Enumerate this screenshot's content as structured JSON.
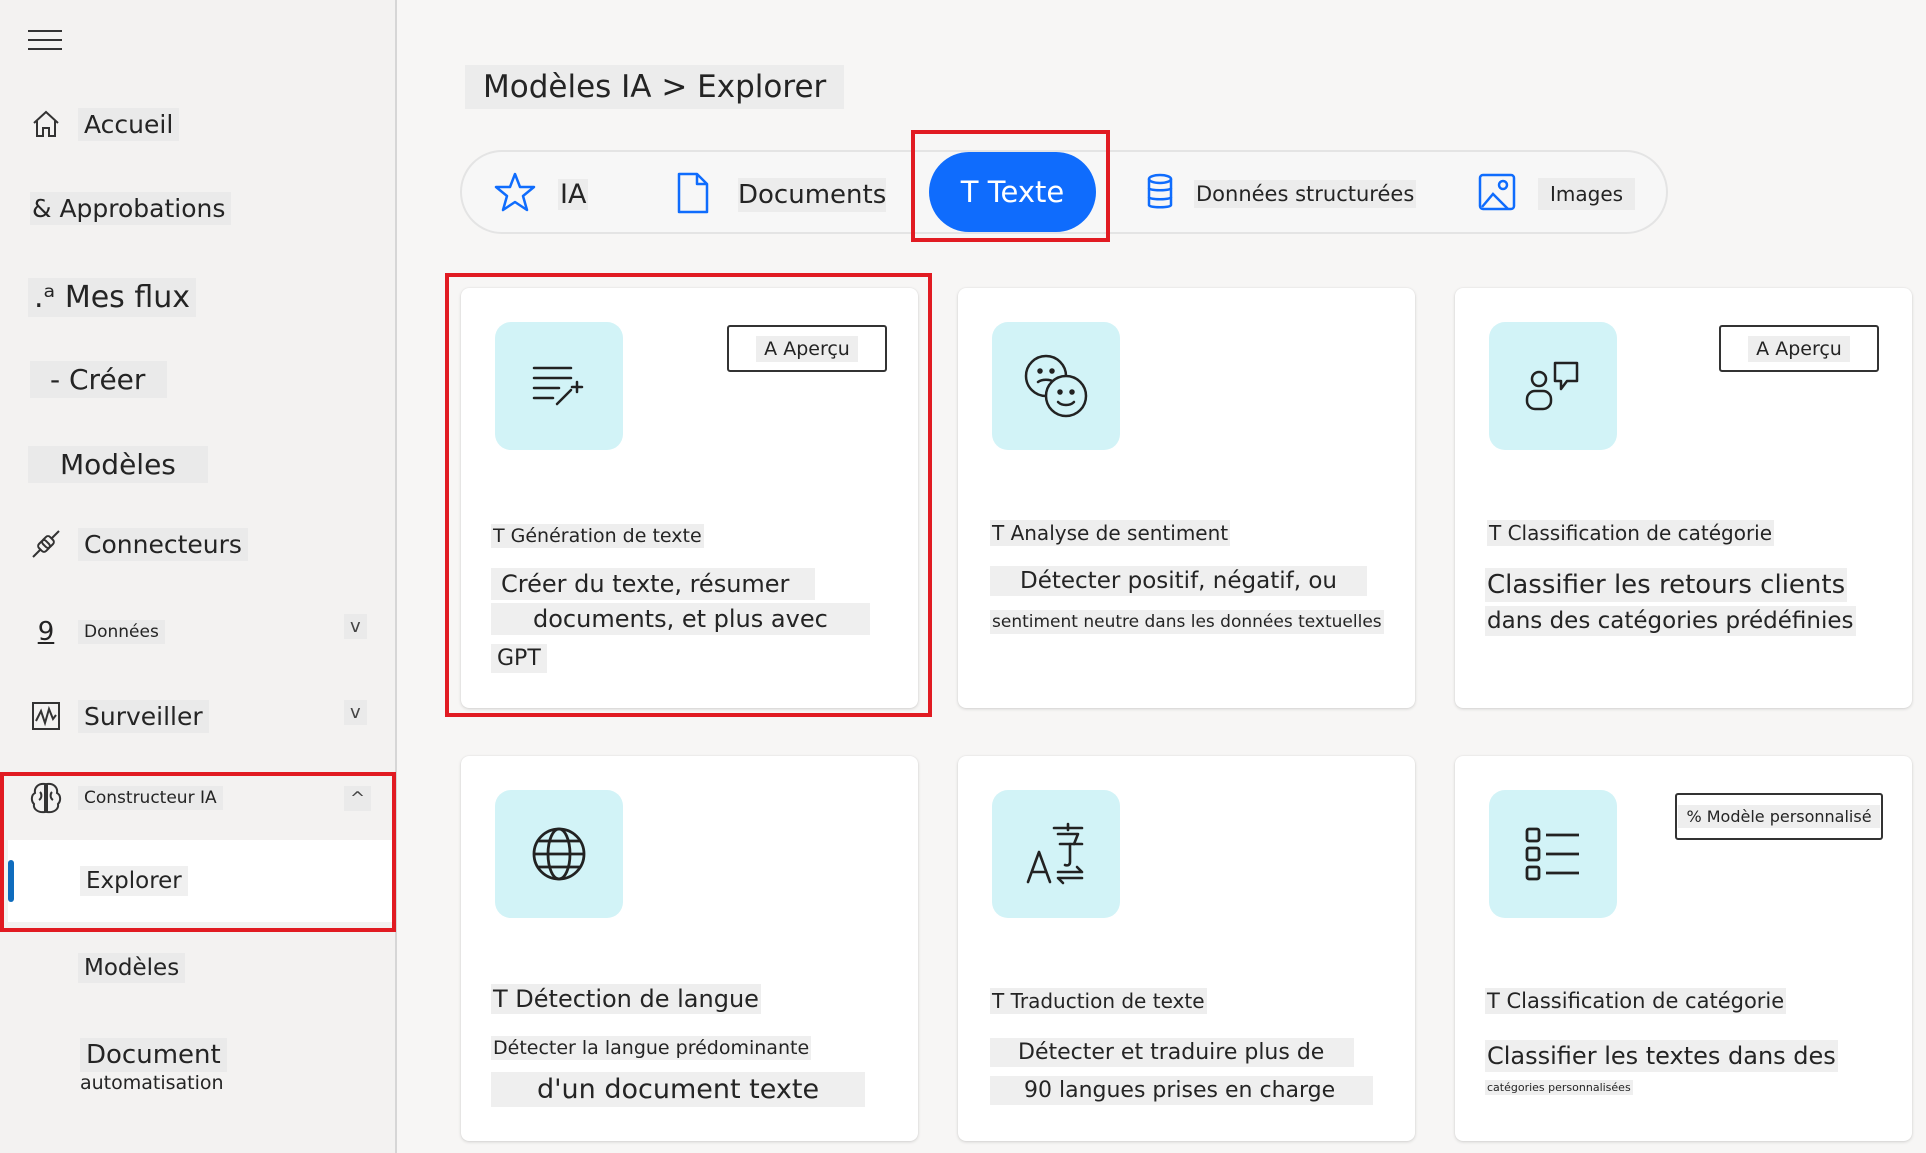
{
  "sidebar": {
    "items": [
      {
        "label": "Accueil",
        "icon": "home-icon"
      },
      {
        "label": "& Approbations"
      },
      {
        "label": ".ᵃ Mes flux"
      },
      {
        "label": "- Créer"
      },
      {
        "label": "Modèles"
      },
      {
        "label": "Connecteurs",
        "icon": "connector-plug-icon"
      },
      {
        "label": "Données",
        "icon_text": "9",
        "chevron": "v"
      },
      {
        "label": "Surveiller",
        "icon": "monitor-chart-icon",
        "chevron": "v"
      },
      {
        "label": "Constructeur IA",
        "icon": "brain-icon",
        "chevron": "^"
      },
      {
        "label": "Explorer"
      },
      {
        "label": "Modèles"
      },
      {
        "label": "Document",
        "label2": "automatisation"
      }
    ]
  },
  "breadcrumb": "Modèles IA > Explorer",
  "tabs": [
    {
      "label": "IA",
      "icon": "star-icon"
    },
    {
      "label": "Documents",
      "icon": "document-icon"
    },
    {
      "label": "T Texte",
      "selected": true
    },
    {
      "label": "Données structurées",
      "icon": "database-icon"
    },
    {
      "label": "Images",
      "icon": "image-icon"
    }
  ],
  "cards": [
    {
      "title": "T Génération de texte",
      "badge": "A Aperçu",
      "icon": "text-sparkle-icon",
      "desc": [
        "Créer du texte, résumer",
        "documents, et plus avec",
        "GPT"
      ]
    },
    {
      "title": "T Analyse de sentiment",
      "icon": "sentiment-faces-icon",
      "desc": [
        "Détecter positif, négatif, ou",
        "sentiment neutre dans les données textuelles"
      ]
    },
    {
      "title": "T Classification de catégorie",
      "badge": "A Aperçu",
      "icon": "category-chat-icon",
      "desc": [
        "Classifier les retours clients",
        "dans des catégories prédéfinies"
      ]
    },
    {
      "title": "T Détection de langue",
      "icon": "globe-icon",
      "desc": [
        "Détecter la langue prédominante",
        "d'un document texte"
      ]
    },
    {
      "title": "T Traduction de texte",
      "icon": "translate-icon",
      "desc": [
        "Détecter et traduire plus de",
        "90 langues prises en charge"
      ]
    },
    {
      "title": "T Classification de catégorie",
      "badge": "% Modèle personnalisé",
      "icon": "list-icon",
      "desc": [
        "Classifier les textes dans des",
        "catégories personnalisées"
      ]
    }
  ],
  "colors": {
    "accent": "#0f6cfd",
    "highlight_box": "#e11b22",
    "icon_tile": "#d2f3f7"
  }
}
